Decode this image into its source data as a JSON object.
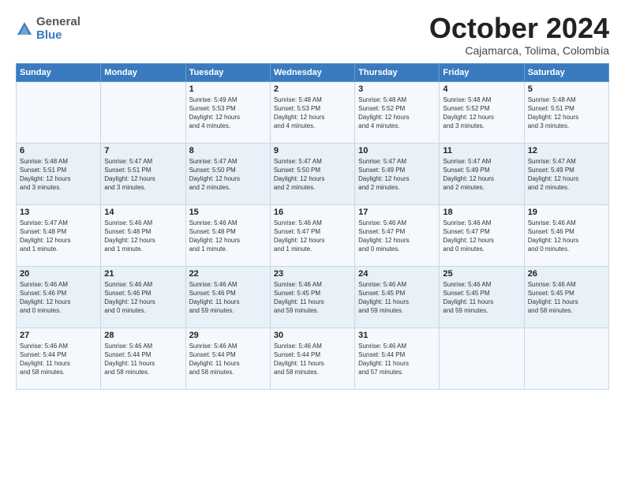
{
  "logo": {
    "general": "General",
    "blue": "Blue"
  },
  "title": "October 2024",
  "location": "Cajamarca, Tolima, Colombia",
  "days_header": [
    "Sunday",
    "Monday",
    "Tuesday",
    "Wednesday",
    "Thursday",
    "Friday",
    "Saturday"
  ],
  "weeks": [
    [
      {
        "day": "",
        "info": ""
      },
      {
        "day": "",
        "info": ""
      },
      {
        "day": "1",
        "info": "Sunrise: 5:49 AM\nSunset: 5:53 PM\nDaylight: 12 hours\nand 4 minutes."
      },
      {
        "day": "2",
        "info": "Sunrise: 5:48 AM\nSunset: 5:53 PM\nDaylight: 12 hours\nand 4 minutes."
      },
      {
        "day": "3",
        "info": "Sunrise: 5:48 AM\nSunset: 5:52 PM\nDaylight: 12 hours\nand 4 minutes."
      },
      {
        "day": "4",
        "info": "Sunrise: 5:48 AM\nSunset: 5:52 PM\nDaylight: 12 hours\nand 3 minutes."
      },
      {
        "day": "5",
        "info": "Sunrise: 5:48 AM\nSunset: 5:51 PM\nDaylight: 12 hours\nand 3 minutes."
      }
    ],
    [
      {
        "day": "6",
        "info": "Sunrise: 5:48 AM\nSunset: 5:51 PM\nDaylight: 12 hours\nand 3 minutes."
      },
      {
        "day": "7",
        "info": "Sunrise: 5:47 AM\nSunset: 5:51 PM\nDaylight: 12 hours\nand 3 minutes."
      },
      {
        "day": "8",
        "info": "Sunrise: 5:47 AM\nSunset: 5:50 PM\nDaylight: 12 hours\nand 2 minutes."
      },
      {
        "day": "9",
        "info": "Sunrise: 5:47 AM\nSunset: 5:50 PM\nDaylight: 12 hours\nand 2 minutes."
      },
      {
        "day": "10",
        "info": "Sunrise: 5:47 AM\nSunset: 5:49 PM\nDaylight: 12 hours\nand 2 minutes."
      },
      {
        "day": "11",
        "info": "Sunrise: 5:47 AM\nSunset: 5:49 PM\nDaylight: 12 hours\nand 2 minutes."
      },
      {
        "day": "12",
        "info": "Sunrise: 5:47 AM\nSunset: 5:49 PM\nDaylight: 12 hours\nand 2 minutes."
      }
    ],
    [
      {
        "day": "13",
        "info": "Sunrise: 5:47 AM\nSunset: 5:48 PM\nDaylight: 12 hours\nand 1 minute."
      },
      {
        "day": "14",
        "info": "Sunrise: 5:46 AM\nSunset: 5:48 PM\nDaylight: 12 hours\nand 1 minute."
      },
      {
        "day": "15",
        "info": "Sunrise: 5:46 AM\nSunset: 5:48 PM\nDaylight: 12 hours\nand 1 minute."
      },
      {
        "day": "16",
        "info": "Sunrise: 5:46 AM\nSunset: 5:47 PM\nDaylight: 12 hours\nand 1 minute."
      },
      {
        "day": "17",
        "info": "Sunrise: 5:46 AM\nSunset: 5:47 PM\nDaylight: 12 hours\nand 0 minutes."
      },
      {
        "day": "18",
        "info": "Sunrise: 5:46 AM\nSunset: 5:47 PM\nDaylight: 12 hours\nand 0 minutes."
      },
      {
        "day": "19",
        "info": "Sunrise: 5:46 AM\nSunset: 5:46 PM\nDaylight: 12 hours\nand 0 minutes."
      }
    ],
    [
      {
        "day": "20",
        "info": "Sunrise: 5:46 AM\nSunset: 5:46 PM\nDaylight: 12 hours\nand 0 minutes."
      },
      {
        "day": "21",
        "info": "Sunrise: 5:46 AM\nSunset: 5:46 PM\nDaylight: 12 hours\nand 0 minutes."
      },
      {
        "day": "22",
        "info": "Sunrise: 5:46 AM\nSunset: 5:46 PM\nDaylight: 11 hours\nand 59 minutes."
      },
      {
        "day": "23",
        "info": "Sunrise: 5:46 AM\nSunset: 5:45 PM\nDaylight: 11 hours\nand 59 minutes."
      },
      {
        "day": "24",
        "info": "Sunrise: 5:46 AM\nSunset: 5:45 PM\nDaylight: 11 hours\nand 59 minutes."
      },
      {
        "day": "25",
        "info": "Sunrise: 5:46 AM\nSunset: 5:45 PM\nDaylight: 11 hours\nand 59 minutes."
      },
      {
        "day": "26",
        "info": "Sunrise: 5:46 AM\nSunset: 5:45 PM\nDaylight: 11 hours\nand 58 minutes."
      }
    ],
    [
      {
        "day": "27",
        "info": "Sunrise: 5:46 AM\nSunset: 5:44 PM\nDaylight: 11 hours\nand 58 minutes."
      },
      {
        "day": "28",
        "info": "Sunrise: 5:46 AM\nSunset: 5:44 PM\nDaylight: 11 hours\nand 58 minutes."
      },
      {
        "day": "29",
        "info": "Sunrise: 5:46 AM\nSunset: 5:44 PM\nDaylight: 11 hours\nand 58 minutes."
      },
      {
        "day": "30",
        "info": "Sunrise: 5:46 AM\nSunset: 5:44 PM\nDaylight: 11 hours\nand 58 minutes."
      },
      {
        "day": "31",
        "info": "Sunrise: 5:46 AM\nSunset: 5:44 PM\nDaylight: 11 hours\nand 57 minutes."
      },
      {
        "day": "",
        "info": ""
      },
      {
        "day": "",
        "info": ""
      }
    ]
  ]
}
